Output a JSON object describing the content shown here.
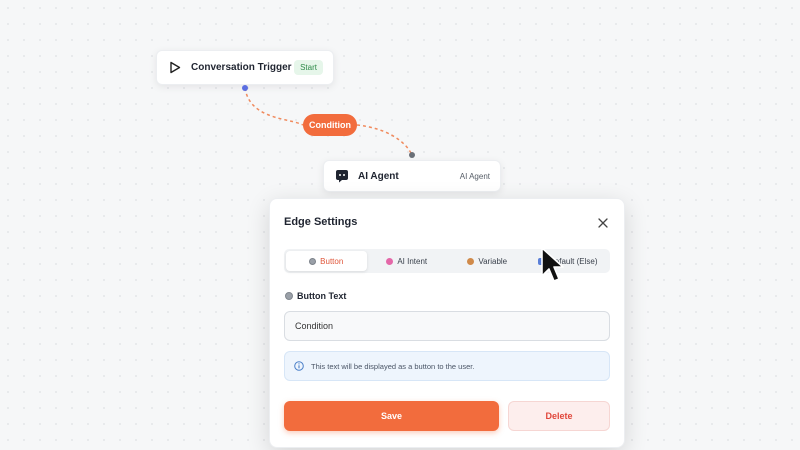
{
  "canvas": {
    "trigger_node": {
      "title": "Conversation Trigger",
      "tag": "Start",
      "icon": "play-icon"
    },
    "agent_node": {
      "title": "AI Agent",
      "tag": "AI Agent",
      "icon": "chat-bubble-icon"
    },
    "edge": {
      "label": "Condition",
      "color": "#f26c3d"
    }
  },
  "dialog": {
    "title": "Edge Settings",
    "tabs": [
      {
        "label": "Button",
        "icon": "button-icon",
        "active": true
      },
      {
        "label": "AI Intent",
        "icon": "ai-intent-icon",
        "active": false
      },
      {
        "label": "Variable",
        "icon": "variable-icon",
        "active": false
      },
      {
        "label": "Default (Else)",
        "icon": "default-icon",
        "active": false
      }
    ],
    "field_label": "Button Text",
    "field_value": "Condition",
    "info_text": "This text will be displayed as a button to the user.",
    "save_label": "Save",
    "delete_label": "Delete"
  },
  "colors": {
    "accent": "#f26c3d",
    "danger": "#e0463a",
    "start_green": "#2e8b49"
  }
}
